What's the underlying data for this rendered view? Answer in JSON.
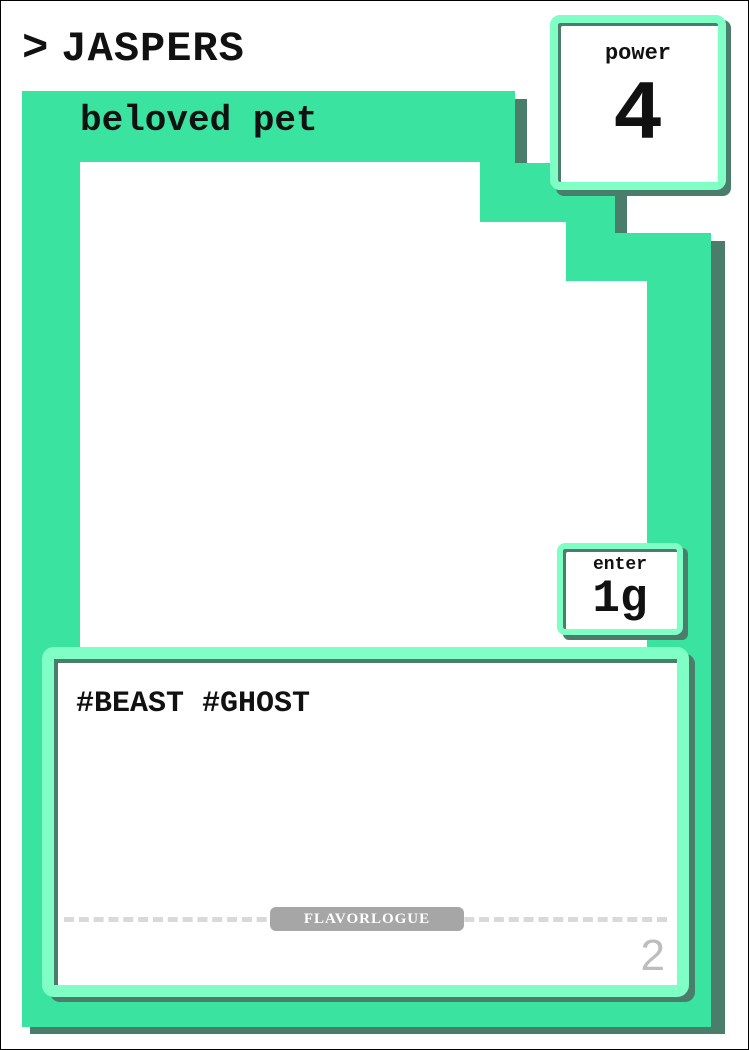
{
  "card": {
    "name": "JASPERS",
    "name_prefix_icon": "chevron-right-icon",
    "subtitle": "beloved pet",
    "power": {
      "label": "power",
      "value": "4"
    },
    "enter": {
      "label": "enter",
      "value": "1g"
    },
    "tags": "#BEAST #GHOST",
    "flavor_label": "FLAVORLOGUE",
    "number": "2"
  },
  "colors": {
    "body": "#3ae3a0",
    "frame_light": "#7fffc6",
    "shadow": "#4a7d6a",
    "flavor_pill": "#a6a6a6",
    "number": "#bdbdbd"
  }
}
